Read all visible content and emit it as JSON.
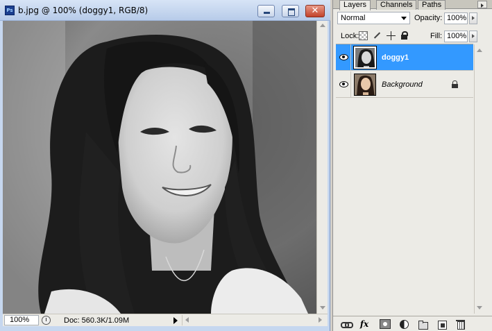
{
  "document": {
    "title": "b.jpg @ 100% (doggy1, RGB/8)",
    "app_icon_label": "Ps",
    "close_glyph": "✕",
    "zoom": "100%",
    "doc_info": "Doc: 560.3K/1.09M"
  },
  "layers_panel": {
    "tabs": [
      {
        "label": "Layers",
        "active": true
      },
      {
        "label": "Channels",
        "active": false
      },
      {
        "label": "Paths",
        "active": false
      }
    ],
    "blend_mode": "Normal",
    "opacity_label": "Opacity:",
    "opacity_value": "100%",
    "lock_label": "Lock:",
    "fill_label": "Fill:",
    "fill_value": "100%",
    "layers": [
      {
        "name": "doggy1",
        "selected": true,
        "visible": true,
        "locked": false,
        "thumb_icon": "grayscale-portrait-thumbnail"
      },
      {
        "name": "Background",
        "selected": false,
        "visible": true,
        "locked": true,
        "thumb_icon": "color-portrait-thumbnail"
      }
    ],
    "footer_labels": {
      "fx": "fx"
    }
  },
  "colors": {
    "selection": "#3399ff",
    "titlebar": "#c6d7ef",
    "close_button": "#c2422a",
    "panel_bg": "#ecebe6"
  }
}
